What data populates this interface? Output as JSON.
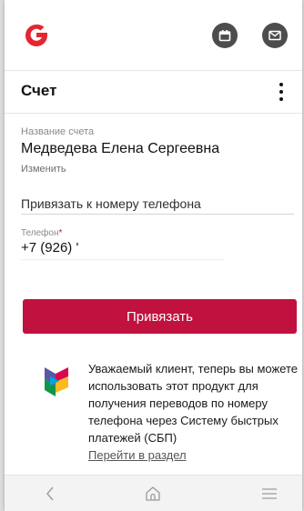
{
  "header": {
    "logo_icon": "brand-g-logo-icon",
    "brand_color": "#e3262f",
    "calendar_icon": "calendar-icon",
    "mail_icon": "mail-icon"
  },
  "screen": {
    "title": "Счет",
    "more_icon": "more-vertical-icon"
  },
  "account": {
    "name_label": "Название счета",
    "name_value": "Медведева Елена Сергеевна",
    "edit_link": "Изменить"
  },
  "binding": {
    "select_value": "Привязать к номеру телефона",
    "phone_label": "Телефон",
    "required_mark": "*",
    "phone_value": "+7 (926) '"
  },
  "actions": {
    "bind_button": "Привязать",
    "button_color": "#c0113f"
  },
  "sbp_notice": {
    "icon": "sbp-logo-icon",
    "text": "Уважаемый клиент, теперь вы можете использовать этот продукт для получения переводов по номеру телефона через Систему быстрых платежей (СБП)",
    "link": "Перейти в раздел"
  },
  "navbar": {
    "back_icon": "chevron-left-icon",
    "home_icon": "home-icon",
    "menu_icon": "menu-icon"
  }
}
